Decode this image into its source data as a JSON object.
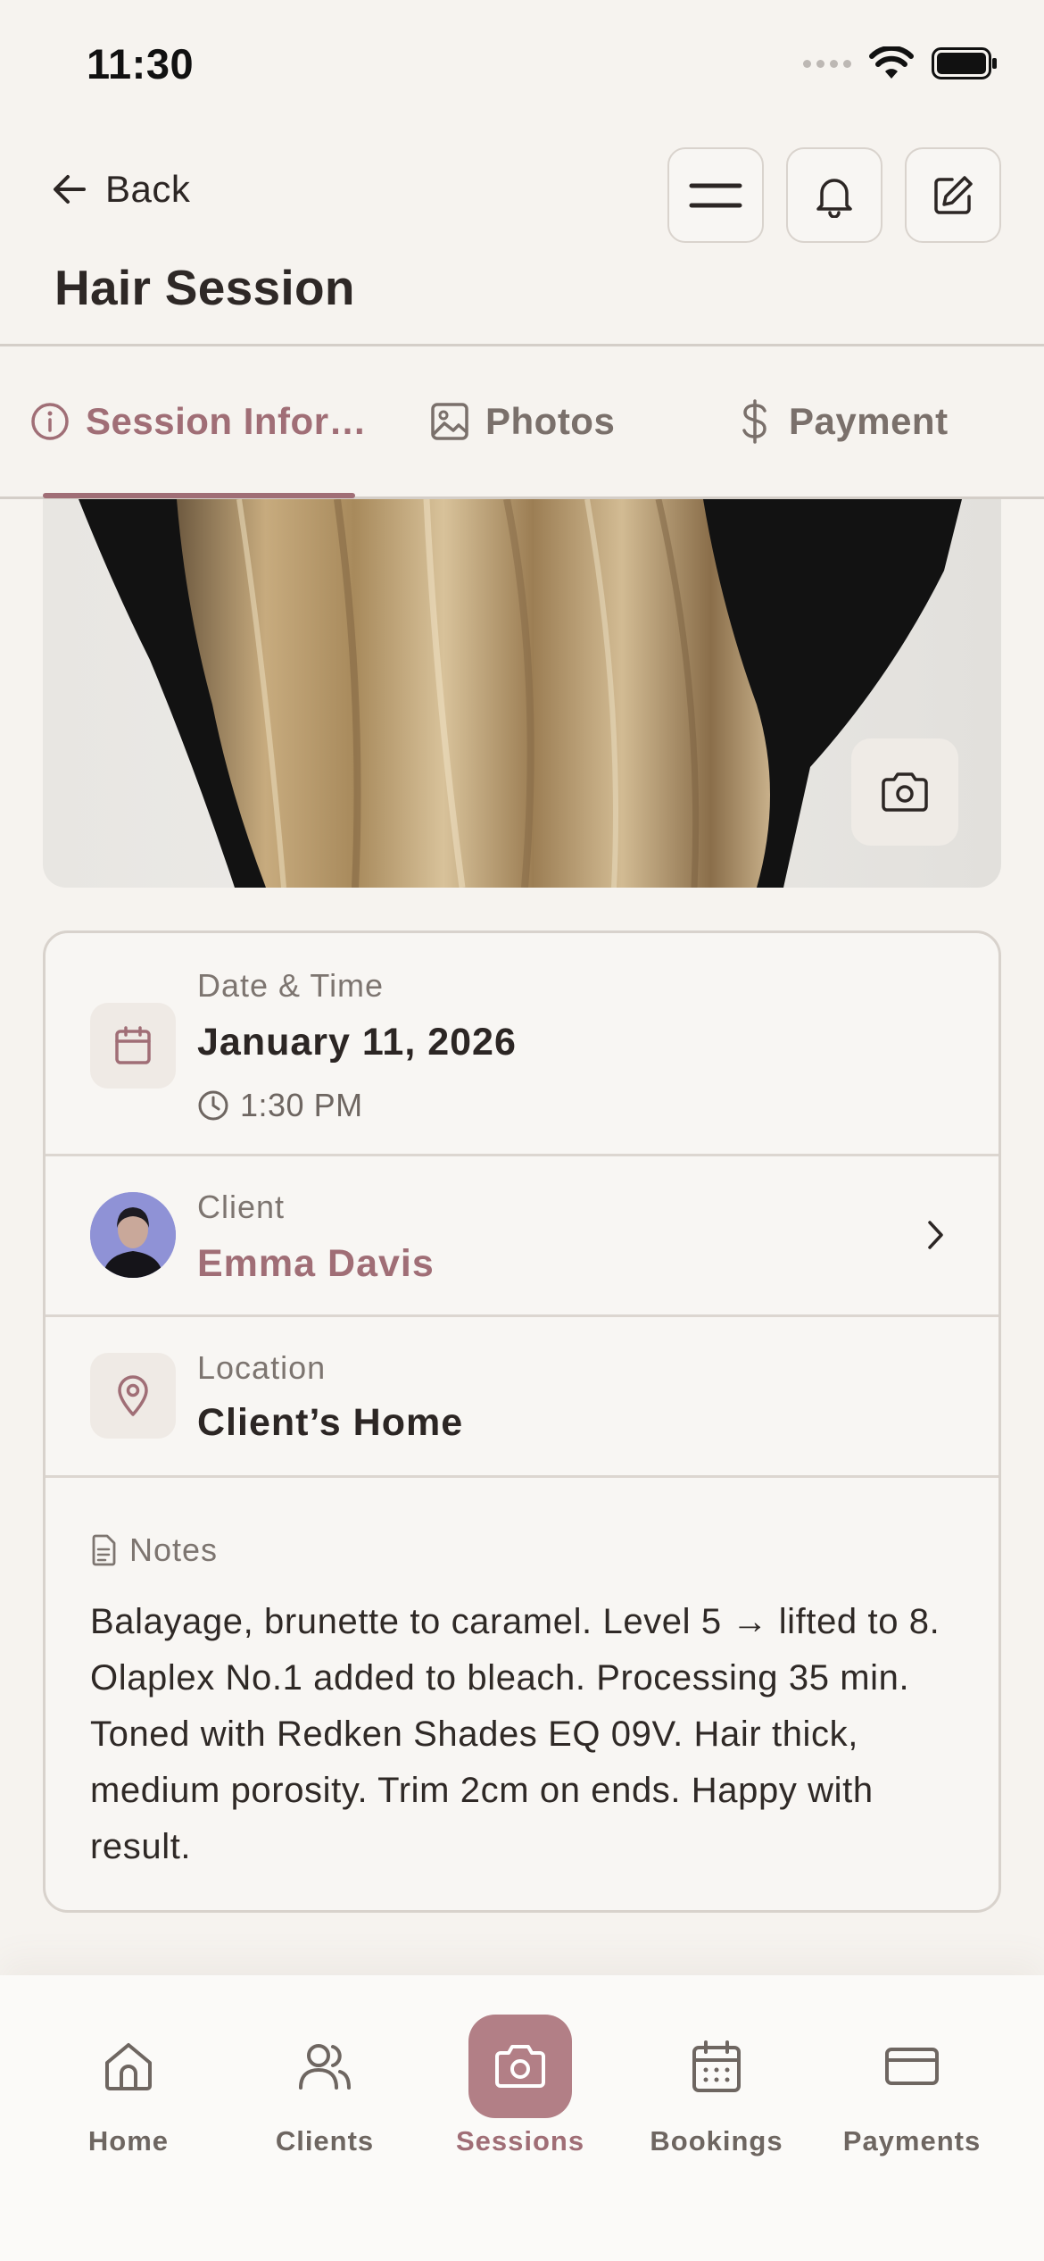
{
  "status_bar": {
    "time": "11:30"
  },
  "header": {
    "back_label": "Back",
    "title": "Hair Session",
    "actions": [
      "menu-icon",
      "bell-icon",
      "edit-icon"
    ]
  },
  "tabs": [
    {
      "label": "Session Infor…",
      "icon": "info-icon",
      "active": true
    },
    {
      "label": "Photos",
      "icon": "image-icon",
      "active": false
    },
    {
      "label": "Payment",
      "icon": "dollar-icon",
      "active": false
    }
  ],
  "session": {
    "date_label": "Date & Time",
    "date": "January 11, 2026",
    "time": "1:30 PM",
    "client_label": "Client",
    "client_name": "Emma Davis",
    "location_label": "Location",
    "location": "Client’s Home",
    "notes_label": "Notes",
    "notes": "Balayage, brunette to caramel. Level 5 → lifted to 8. Olaplex No.1 added to bleach. Processing 35 min. Toned with Redken Shades EQ 09V. Hair thick, medium porosity. Trim 2cm on ends. Happy with result."
  },
  "bottom_nav": [
    {
      "label": "Home",
      "icon": "home-icon",
      "active": false
    },
    {
      "label": "Clients",
      "icon": "users-icon",
      "active": false
    },
    {
      "label": "Sessions",
      "icon": "camera-icon",
      "active": true
    },
    {
      "label": "Bookings",
      "icon": "calendar-icon",
      "active": false
    },
    {
      "label": "Payments",
      "icon": "card-icon",
      "active": false
    }
  ],
  "colors": {
    "accent": "#a06e76",
    "accent_fill": "#b27f86",
    "background": "#f6f3ef",
    "border": "#d8d2cc"
  }
}
